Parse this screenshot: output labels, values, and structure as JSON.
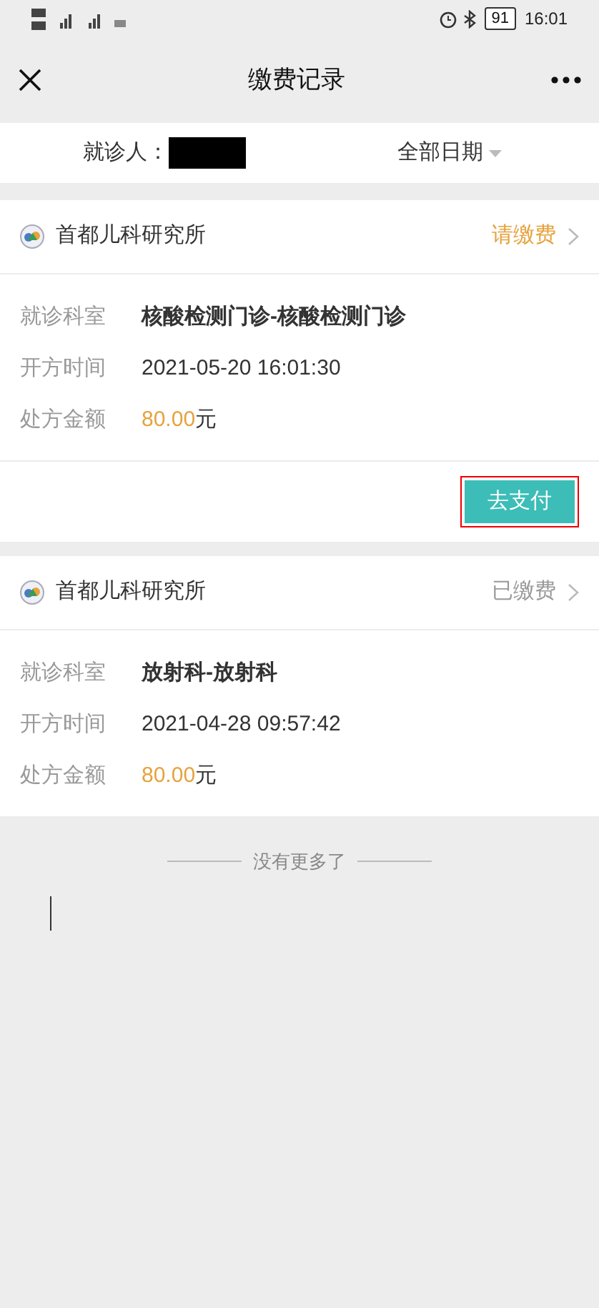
{
  "status_bar": {
    "battery": "91",
    "time": "16:01"
  },
  "nav": {
    "title": "缴费记录"
  },
  "filter": {
    "patient_label": "就诊人：",
    "date_filter": "全部日期"
  },
  "records": [
    {
      "hospital": "首都儿科研究所",
      "status": "请缴费",
      "kind": "unpaid",
      "rows": [
        {
          "label": "就诊科室",
          "value": "核酸检测门诊-核酸检测门诊",
          "kind": "dept"
        },
        {
          "label": "开方时间",
          "value": "2021-05-20 16:01:30",
          "kind": "time"
        },
        {
          "label": "处方金额",
          "value": "80.00",
          "unit": "元",
          "kind": "amount"
        }
      ],
      "action": "去支付"
    },
    {
      "hospital": "首都儿科研究所",
      "status": "已缴费",
      "kind": "paid",
      "rows": [
        {
          "label": "就诊科室",
          "value": "放射科-放射科",
          "kind": "dept"
        },
        {
          "label": "开方时间",
          "value": "2021-04-28 09:57:42",
          "kind": "time"
        },
        {
          "label": "处方金额",
          "value": "80.00",
          "unit": "元",
          "kind": "amount"
        }
      ]
    }
  ],
  "footer": "没有更多了"
}
